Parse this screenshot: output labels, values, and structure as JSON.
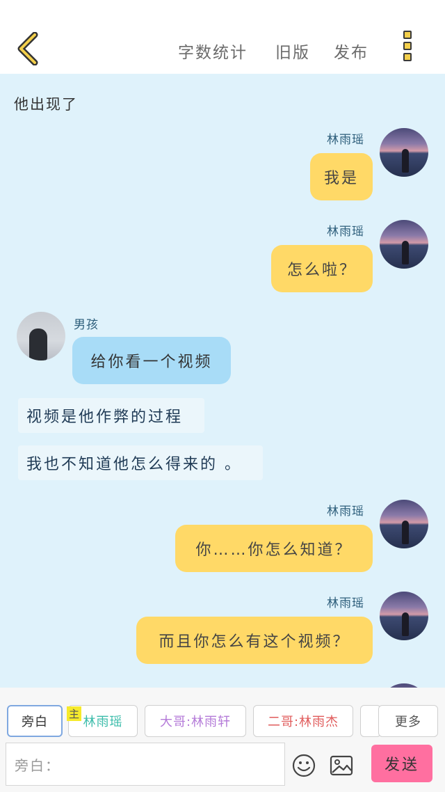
{
  "header": {
    "word_count": "字数统计",
    "old_version": "旧版",
    "publish": "发布"
  },
  "chat": {
    "top_narration": "他出现了",
    "messages": [
      {
        "speaker": "林雨瑶",
        "text": "我是"
      },
      {
        "speaker": "林雨瑶",
        "text": "怎么啦？"
      },
      {
        "speaker": "男孩",
        "text": "给你看一个视频"
      },
      {
        "narration": "视频是他作弊的过程"
      },
      {
        "narration": "我也不知道他怎么得来的 。"
      },
      {
        "speaker": "林雨瑶",
        "text": "你……你怎么知道？"
      },
      {
        "speaker": "林雨瑶",
        "text": "而且你怎么有这个视频？"
      }
    ]
  },
  "roles": {
    "narrator": "旁白",
    "main_badge": "主",
    "main": "林雨瑶",
    "brother1": "大哥:林雨轩",
    "brother2": "二哥:林雨杰",
    "more": "更多"
  },
  "input": {
    "placeholder": "旁白："
  },
  "send_label": "发送",
  "colors": {
    "background": "#dff2fb",
    "yellow_bubble": "#ffd967",
    "blue_bubble": "#a8dcf7",
    "send": "#ff6fa0"
  }
}
